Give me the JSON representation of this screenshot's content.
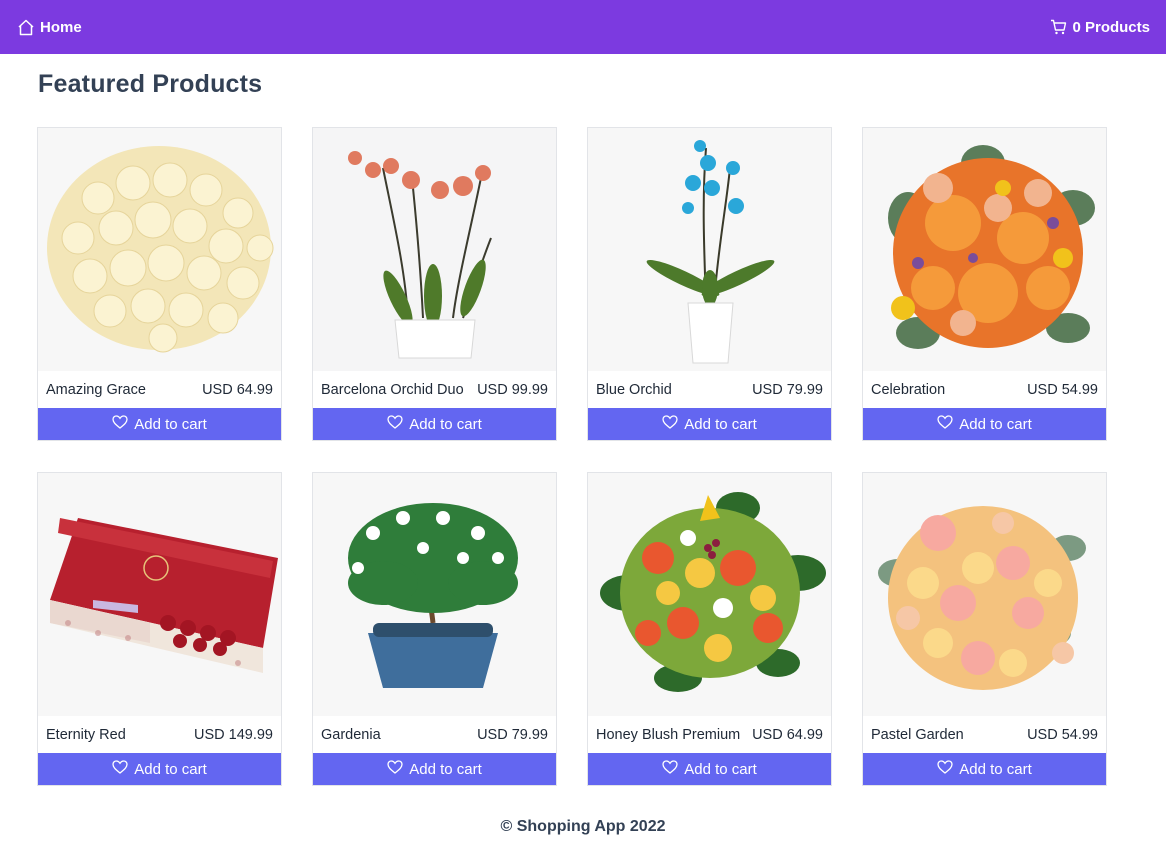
{
  "navbar": {
    "home_label": "Home",
    "home_icon": "house-icon",
    "cart_label": "0 Products",
    "cart_icon": "cart-icon",
    "background": "#7c3ae0"
  },
  "main": {
    "title": "Featured Products",
    "products": [
      {
        "name": "Amazing Grace",
        "price": "USD 64.99",
        "button": "Add to cart"
      },
      {
        "name": "Barcelona Orchid Duo",
        "price": "USD 99.99",
        "button": "Add to cart"
      },
      {
        "name": "Blue Orchid",
        "price": "USD 79.99",
        "button": "Add to cart"
      },
      {
        "name": "Celebration",
        "price": "USD 54.99",
        "button": "Add to cart"
      },
      {
        "name": "Eternity Red",
        "price": "USD 149.99",
        "button": "Add to cart"
      },
      {
        "name": "Gardenia",
        "price": "USD 79.99",
        "button": "Add to cart"
      },
      {
        "name": "Honey Blush Premium",
        "price": "USD 64.99",
        "button": "Add to cart"
      },
      {
        "name": "Pastel Garden",
        "price": "USD 54.99",
        "button": "Add to cart"
      }
    ],
    "button_color": "#6366f1",
    "button_icon": "heart-icon"
  },
  "footer": {
    "text": "© Shopping App 2022"
  }
}
